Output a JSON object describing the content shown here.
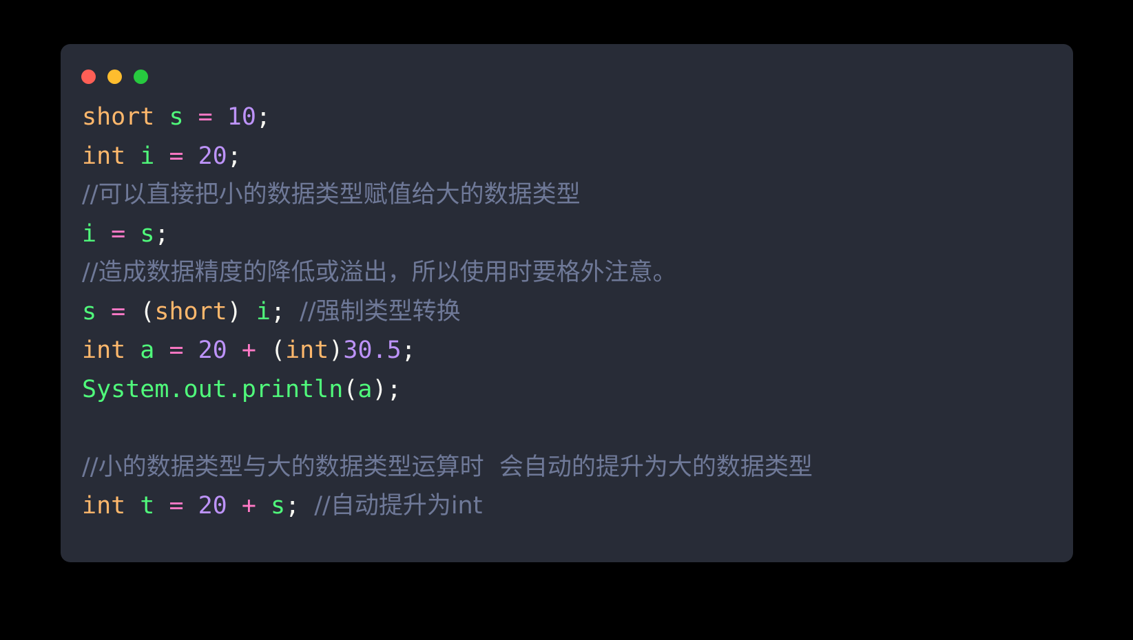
{
  "window": {
    "background_color": "#000000",
    "panel_color": "#282c37",
    "traffic_lights": [
      {
        "name": "close",
        "color": "#ff5f56"
      },
      {
        "name": "minimize",
        "color": "#ffbd2e"
      },
      {
        "name": "maximize",
        "color": "#27c93f"
      }
    ]
  },
  "theme": {
    "keyword": "#ffb86c",
    "identifier": "#50fa7b",
    "operator": "#ff79c6",
    "number": "#bd93f9",
    "punctuation": "#f8f8f2",
    "comment": "#6f7998"
  },
  "code": {
    "language": "java",
    "lines": [
      {
        "n": 1,
        "text": "short s = 10;"
      },
      {
        "n": 2,
        "text": "int i = 20;"
      },
      {
        "n": 3,
        "text": "//可以直接把小的数据类型赋值给大的数据类型"
      },
      {
        "n": 4,
        "text": "i = s;"
      },
      {
        "n": 5,
        "text": "//造成数据精度的降低或溢出，所以使用时要格外注意。"
      },
      {
        "n": 6,
        "text": "s = (short) i; //强制类型转换"
      },
      {
        "n": 7,
        "text": "int a = 20 + (int)30.5;"
      },
      {
        "n": 8,
        "text": "System.out.println(a);"
      },
      {
        "n": 9,
        "text": ""
      },
      {
        "n": 10,
        "text": "//小的数据类型与大的数据类型运算时  会自动的提升为大的数据类型"
      },
      {
        "n": 11,
        "text": "int t = 20 + s; //自动提升为int"
      }
    ],
    "tokens": {
      "l1": {
        "kw": "short",
        "id": "s",
        "op": "=",
        "num": "10",
        "semi": ";"
      },
      "l2": {
        "kw": "int",
        "id": "i",
        "op": "=",
        "num": "20",
        "semi": ";"
      },
      "l3": {
        "comment": "//可以直接把小的数据类型赋值给大的数据类型"
      },
      "l4": {
        "id1": "i",
        "op": "=",
        "id2": "s",
        "semi": ";"
      },
      "l5": {
        "comment": "//造成数据精度的降低或溢出，所以使用时要格外注意。"
      },
      "l6": {
        "id1": "s",
        "op": "=",
        "lparen": "(",
        "kw": "short",
        "rparen": ")",
        "id2": "i",
        "semi": ";",
        "comment": "//强制类型转换"
      },
      "l7": {
        "kw1": "int",
        "id": "a",
        "op1": "=",
        "num1": "20",
        "op2": "+",
        "lparen": "(",
        "kw2": "int",
        "rparen": ")",
        "num2": "30.5",
        "semi": ";"
      },
      "l8": {
        "obj": "System",
        "dot1": ".",
        "field": "out",
        "dot2": ".",
        "method": "println",
        "lparen": "(",
        "arg": "a",
        "rparen": ")",
        "semi": ";"
      },
      "l10": {
        "comment": "//小的数据类型与大的数据类型运算时  会自动的提升为大的数据类型"
      },
      "l11": {
        "kw": "int",
        "id1": "t",
        "op1": "=",
        "num": "20",
        "op2": "+",
        "id2": "s",
        "semi": ";",
        "comment": "//自动提升为int"
      }
    }
  }
}
